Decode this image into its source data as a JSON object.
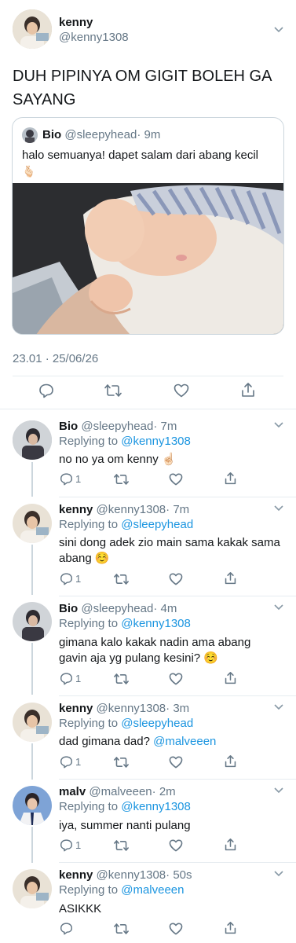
{
  "main_tweet": {
    "display_name": "kenny",
    "handle": "@kenny1308",
    "text": "DUH PIPINYA OM GIGIT BOLEH GA SAYANG",
    "timestamp": "23.01 · 25/06/26",
    "quoted": {
      "display_name": "Bio",
      "handle": "@sleepyhead",
      "time": "· 9m",
      "text": "halo semuanya! dapet salam dari abang kecil",
      "emoji": "🫰🏻"
    }
  },
  "replies": [
    {
      "display_name": "Bio",
      "handle": "@sleepyhead",
      "time": "· 7m",
      "replying_label": "Replying to",
      "replying_to": "@kenny1308",
      "text": "no no ya om kenny ☝🏻",
      "reply_count": "1"
    },
    {
      "display_name": "kenny",
      "handle": "@kenny1308",
      "time": "· 7m",
      "replying_label": "Replying to",
      "replying_to": "@sleepyhead",
      "text_line1": "sini dong adek zio main sama kakak sama",
      "text_line2": "abang ☺️",
      "reply_count": "1"
    },
    {
      "display_name": "Bio",
      "handle": "@sleepyhead",
      "time": "· 4m",
      "replying_label": "Replying to",
      "replying_to": "@kenny1308",
      "text_line1": "gimana kalo kakak nadin ama abang",
      "text_line2": "gavin aja yg pulang kesini? ☺️",
      "reply_count": "1"
    },
    {
      "display_name": "kenny",
      "handle": "@kenny1308",
      "time": "· 3m",
      "replying_label": "Replying to",
      "replying_to": "@sleepyhead",
      "text": "dad gimana dad?",
      "mention": "@malveeen",
      "reply_count": "1"
    },
    {
      "display_name": "malv",
      "handle": "@malveeen",
      "time": "· 2m",
      "replying_label": "Replying to",
      "replying_to": "@kenny1308",
      "text": "iya, summer nanti pulang",
      "reply_count": "1"
    },
    {
      "display_name": "kenny",
      "handle": "@kenny1308",
      "time": "· 50s",
      "replying_label": "Replying to",
      "replying_to": "@malveeen",
      "text": "ASIKKK",
      "reply_count": ""
    }
  ],
  "colors": {
    "accent": "#1b95e0",
    "secondary_text": "#657786",
    "divider": "#e6ecf0",
    "icon": "#657786"
  },
  "icons": [
    "chevron-down-icon",
    "reply-icon",
    "retweet-icon",
    "like-icon",
    "share-icon"
  ]
}
